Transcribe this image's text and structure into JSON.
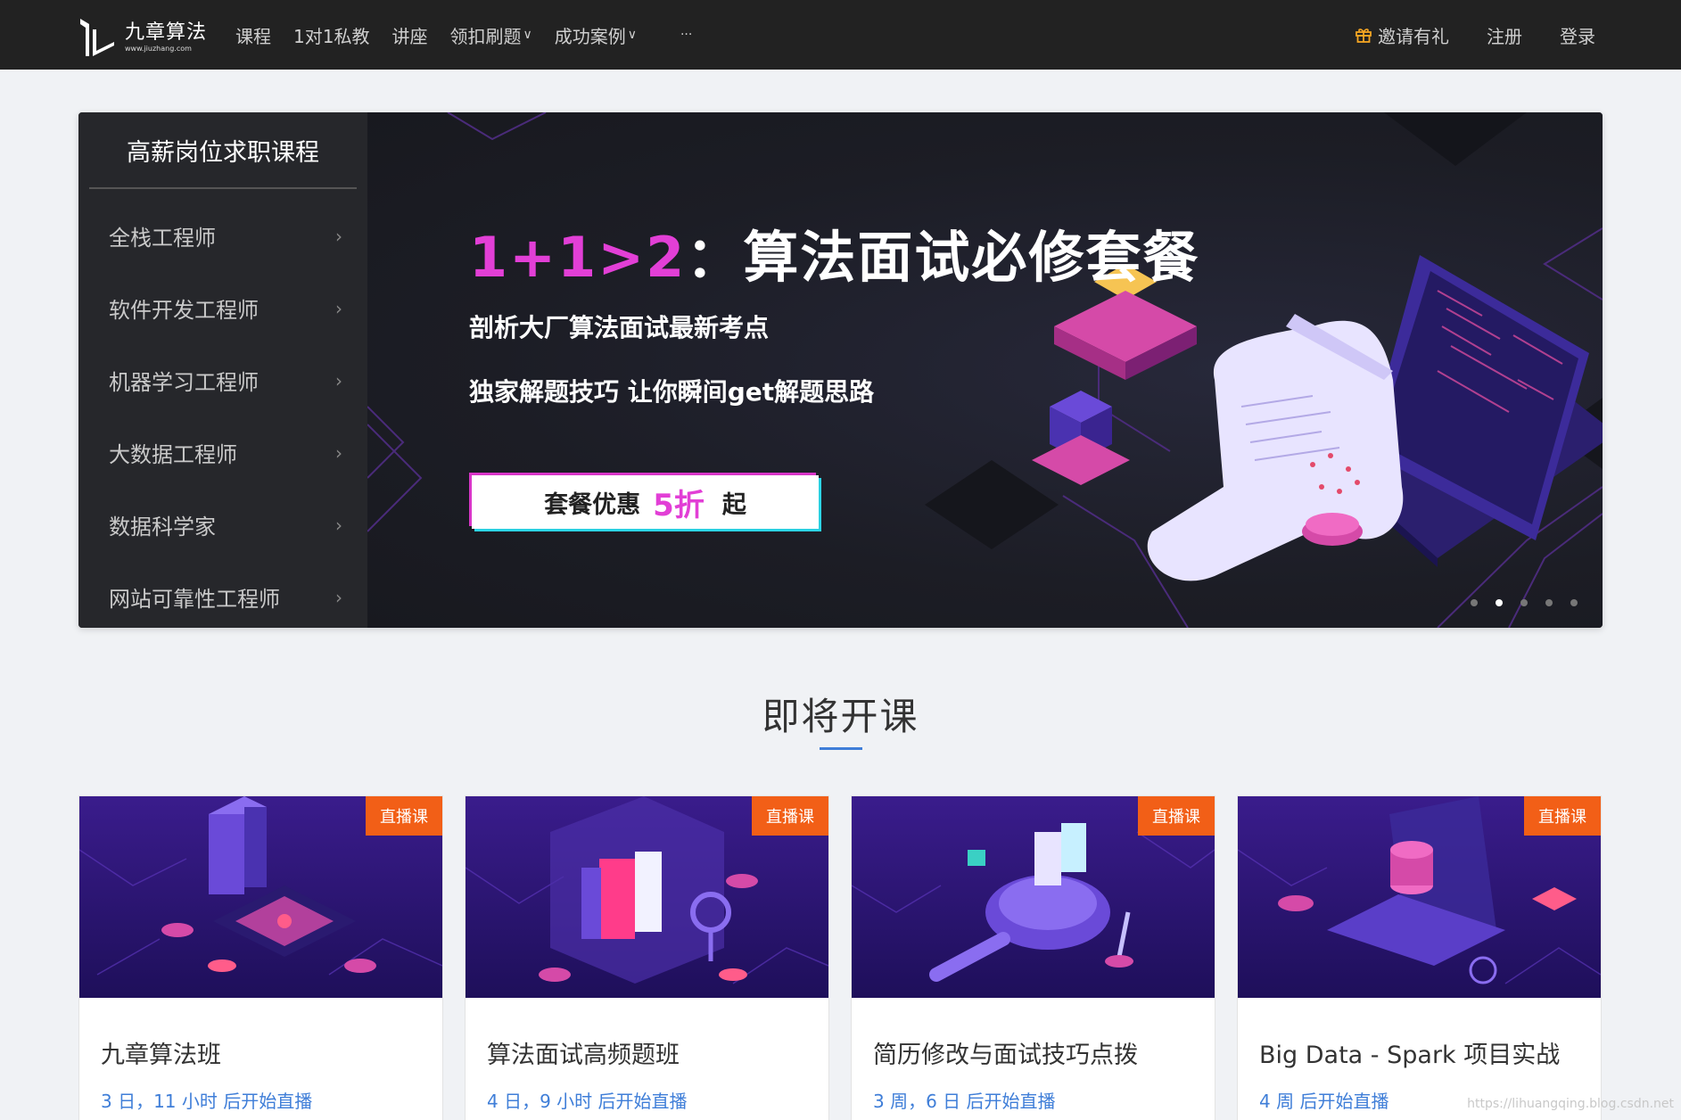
{
  "header": {
    "logo_name": "九章算法",
    "logo_url": "www.jiuzhang.com",
    "nav": [
      {
        "label": "课程",
        "dropdown": false
      },
      {
        "label": "1对1私教",
        "dropdown": false
      },
      {
        "label": "讲座",
        "dropdown": false
      },
      {
        "label": "领扣刷题",
        "dropdown": true
      },
      {
        "label": "成功案例",
        "dropdown": true
      },
      {
        "label": "···",
        "dropdown": false
      }
    ],
    "right": {
      "invite": "邀请有礼",
      "register": "注册",
      "login": "登录"
    },
    "caret_glyph": "∨"
  },
  "side_menu": {
    "title": "高薪岗位求职课程",
    "chevron": "›",
    "items": [
      "全栈工程师",
      "软件开发工程师",
      "机器学习工程师",
      "大数据工程师",
      "数据科学家",
      "网站可靠性工程师"
    ]
  },
  "banner": {
    "title_accent": "1+1>2",
    "title_main": "：算法面试必修套餐",
    "sub1": "剖析大厂算法面试最新考点",
    "sub2": "独家解题技巧 让你瞬间get解题思路",
    "cta_pre": "套餐优惠",
    "cta_highlight": "5折",
    "cta_post": "起",
    "dot_count": 5,
    "active_dot": 1
  },
  "section": {
    "title": "即将开课"
  },
  "cards": [
    {
      "badge": "直播课",
      "title": "九章算法班",
      "time": "3 日，11 小时 后开始直播"
    },
    {
      "badge": "直播课",
      "title": "算法面试高频题班",
      "time": "4 日，9 小时 后开始直播"
    },
    {
      "badge": "直播课",
      "title": "简历修改与面试技巧点拨",
      "time": "3 周，6 日 后开始直播"
    },
    {
      "badge": "直播课",
      "title": "Big Data - Spark 项目实战",
      "time": "4 周 后开始直播"
    }
  ],
  "watermark": "https://lihuangqing.blog.csdn.net",
  "colors": {
    "accent_pink": "#e23fd6",
    "accent_cyan": "#2ad3e4",
    "badge_orange": "#f25f17",
    "link_blue": "#3f7ed8",
    "topbar_bg": "#222222"
  }
}
